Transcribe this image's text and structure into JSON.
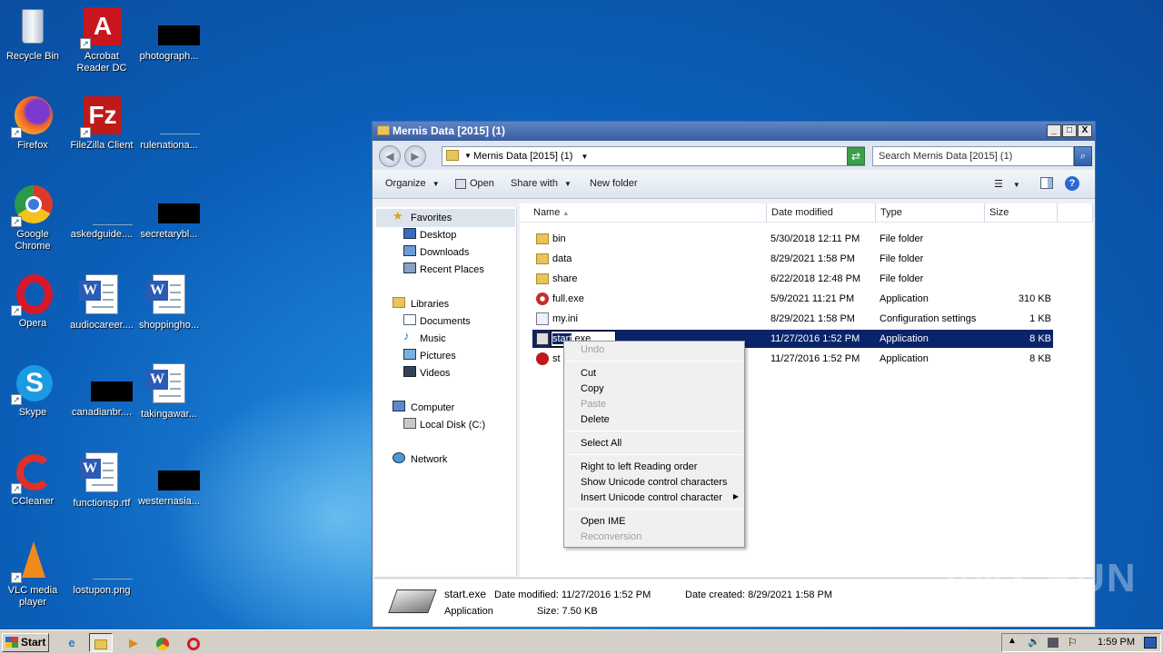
{
  "desktop": {
    "icons": [
      {
        "label": "Recycle Bin"
      },
      {
        "label": "Acrobat Reader DC"
      },
      {
        "label": "photograph..."
      },
      {
        "label": "Firefox"
      },
      {
        "label": "FileZilla Client"
      },
      {
        "label": "rulenationa..."
      },
      {
        "label": "Google Chrome"
      },
      {
        "label": "askedguide...."
      },
      {
        "label": "secretarybl..."
      },
      {
        "label": "Opera"
      },
      {
        "label": "audiocareer...."
      },
      {
        "label": "shoppingho..."
      },
      {
        "label": "Skype"
      },
      {
        "label": "canadianbr...."
      },
      {
        "label": "takingawar..."
      },
      {
        "label": "CCleaner"
      },
      {
        "label": "functionsp.rtf"
      },
      {
        "label": "westernasia..."
      },
      {
        "label": "VLC media player"
      },
      {
        "label": "lostupon.png"
      }
    ]
  },
  "window": {
    "title": "Mernis Data [2015] (1)",
    "controls": {
      "minimize": "_",
      "maximize": "□",
      "close": "X"
    },
    "address": "Mernis Data [2015] (1)",
    "search_placeholder": "Search Mernis Data [2015] (1)",
    "toolbar": {
      "organize": "Organize",
      "open": "Open",
      "share_with": "Share with",
      "new_folder": "New folder"
    },
    "nav": {
      "favorites": "Favorites",
      "desktop": "Desktop",
      "downloads": "Downloads",
      "recent_places": "Recent Places",
      "libraries": "Libraries",
      "documents": "Documents",
      "music": "Music",
      "pictures": "Pictures",
      "videos": "Videos",
      "computer": "Computer",
      "local_disk": "Local Disk (C:)",
      "network": "Network"
    },
    "columns": {
      "name": "Name",
      "date": "Date modified",
      "type": "Type",
      "size": "Size"
    },
    "files": [
      {
        "name": "bin",
        "date": "5/30/2018 12:11 PM",
        "type": "File folder",
        "size": ""
      },
      {
        "name": "data",
        "date": "8/29/2021 1:58 PM",
        "type": "File folder",
        "size": ""
      },
      {
        "name": "share",
        "date": "6/22/2018 12:48 PM",
        "type": "File folder",
        "size": ""
      },
      {
        "name": "full.exe",
        "date": "5/9/2021 11:21 PM",
        "type": "Application",
        "size": "310 KB"
      },
      {
        "name": "my.ini",
        "date": "8/29/2021 1:58 PM",
        "type": "Configuration settings",
        "size": "1 KB"
      },
      {
        "name": "start.exe",
        "date": "11/27/2016 1:52 PM",
        "type": "Application",
        "size": "8 KB"
      },
      {
        "name": "st",
        "date": "11/27/2016 1:52 PM",
        "type": "Application",
        "size": "8 KB"
      }
    ],
    "rename_selected": "start",
    "rename_rest": ".exe",
    "details": {
      "filename": "start.exe",
      "date_modified": "Date modified: 11/27/2016 1:52 PM",
      "date_created": "Date created: 8/29/2021 1:58 PM",
      "type": "Application",
      "size": "Size: 7.50 KB"
    }
  },
  "context_menu": {
    "undo": "Undo",
    "cut": "Cut",
    "copy": "Copy",
    "paste": "Paste",
    "delete": "Delete",
    "select_all": "Select All",
    "rtl": "Right to left Reading order",
    "show_unicode": "Show Unicode control characters",
    "insert_unicode": "Insert Unicode control character",
    "open_ime": "Open IME",
    "reconversion": "Reconversion"
  },
  "taskbar": {
    "start": "Start",
    "clock": "1:59 PM"
  },
  "watermark": "ANY RUN"
}
